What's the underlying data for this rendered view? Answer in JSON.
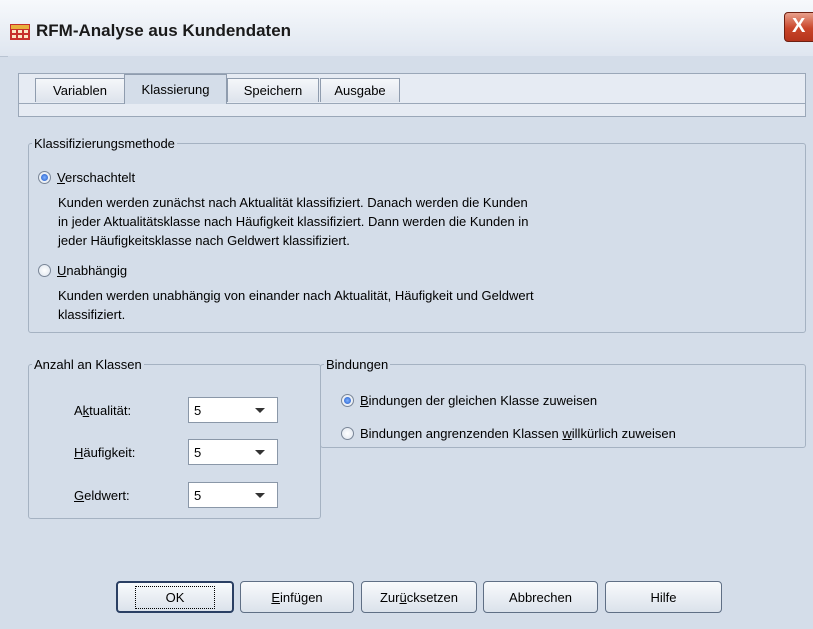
{
  "window": {
    "title": "RFM-Analyse aus Kundendaten",
    "close_symbol": "X"
  },
  "tabs": [
    {
      "label": "Variablen",
      "active": false
    },
    {
      "label": "Klassierung",
      "active": true
    },
    {
      "label": "Speichern",
      "active": false
    },
    {
      "label": "Ausgabe",
      "active": false
    }
  ],
  "method": {
    "legend": "Klassifizierungsmethode",
    "options": [
      {
        "label": "Verschachtelt",
        "mnemonic": "V",
        "rest": "erschachtelt",
        "selected": true,
        "description": [
          "Kunden werden zunächst nach Aktualität klassifiziert. Danach werden die Kunden",
          "in jeder Aktualitätsklasse nach Häufigkeit klassifiziert. Dann werden die Kunden in",
          "jeder Häufigkeitsklasse nach Geldwert klassifiziert."
        ]
      },
      {
        "label": "Unabhängig",
        "mnemonic": "U",
        "rest": "nabhängig",
        "selected": false,
        "description": [
          "Kunden werden unabhängig von einander nach Aktualität, Häufigkeit und Geldwert",
          "klassifiziert."
        ]
      }
    ]
  },
  "bins": {
    "legend": "Anzahl an Klassen",
    "rows": [
      {
        "label": "Aktualität:",
        "pre": "A",
        "mnemonic": "k",
        "post": "tualität:",
        "value": "5"
      },
      {
        "label": "Häufigkeit:",
        "pre": "",
        "mnemonic": "H",
        "post": "äufigkeit:",
        "value": "5"
      },
      {
        "label": "Geldwert:",
        "pre": "",
        "mnemonic": "G",
        "post": "eldwert:",
        "value": "5"
      }
    ]
  },
  "ties": {
    "legend": "Bindungen",
    "options": [
      {
        "label": "Bindungen der gleichen Klasse zuweisen",
        "pre": "",
        "mnemonic": "B",
        "post": "indungen der gleichen Klasse zuweisen",
        "selected": true
      },
      {
        "label": "Bindungen angrenzenden Klassen willkürlich zuweisen",
        "pre": "Bindungen angrenzenden Klassen ",
        "mnemonic": "w",
        "post": "illkürlich zuweisen",
        "selected": false
      }
    ]
  },
  "buttons": [
    {
      "id": "ok",
      "label": "OK",
      "pre": "OK",
      "mnemonic": "",
      "post": ""
    },
    {
      "id": "paste",
      "label": "Einfügen",
      "pre": "",
      "mnemonic": "E",
      "post": "infügen"
    },
    {
      "id": "reset",
      "label": "Zurücksetzen",
      "pre": "Zur",
      "mnemonic": "ü",
      "post": "cksetzen"
    },
    {
      "id": "cancel",
      "label": "Abbrechen",
      "pre": "Abbrechen",
      "mnemonic": "",
      "post": ""
    },
    {
      "id": "help",
      "label": "Hilfe",
      "pre": "Hilfe",
      "mnemonic": "",
      "post": ""
    }
  ],
  "colors": {
    "dialog_bg": "#d4dde9",
    "radio_selected": "#1e56c6",
    "close_button": "#c9452a"
  }
}
